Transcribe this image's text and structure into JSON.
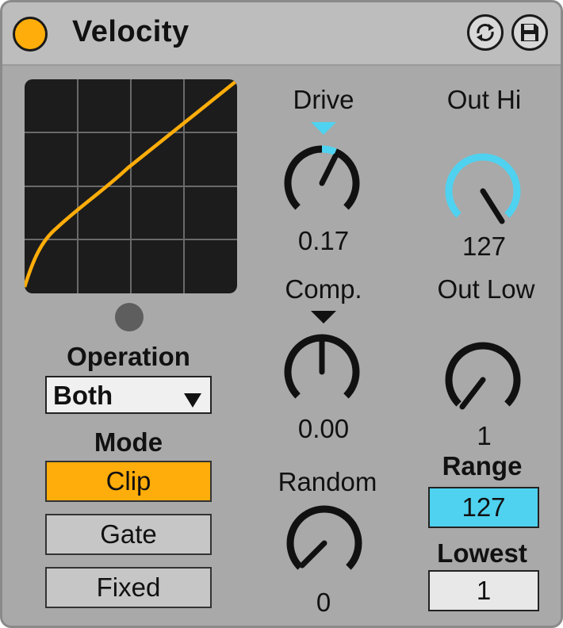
{
  "device": {
    "title": "Velocity",
    "power_on": true,
    "icons": {
      "power": "power-toggle-icon",
      "hot_swap": "hot-swap-icon",
      "save": "save-preset-icon"
    }
  },
  "colors": {
    "accent": "#ffad0a",
    "knob_highlight": "#4fd2f0",
    "background": "#a9a9a9",
    "graph_bg": "#1c1c1c"
  },
  "operation": {
    "label": "Operation",
    "selected": "Both",
    "arrow": "▼"
  },
  "mode": {
    "label": "Mode",
    "options": [
      "Clip",
      "Gate",
      "Fixed"
    ],
    "active": "Clip"
  },
  "knobs": {
    "drive": {
      "label": "Drive",
      "value": "0.17"
    },
    "comp": {
      "label": "Comp.",
      "value": "0.00"
    },
    "random": {
      "label": "Random",
      "value": "0"
    },
    "out_hi": {
      "label": "Out Hi",
      "value": "127"
    },
    "out_low": {
      "label": "Out Low",
      "value": "1"
    }
  },
  "range": {
    "label": "Range",
    "value": "127"
  },
  "lowest": {
    "label": "Lowest",
    "value": "1"
  }
}
